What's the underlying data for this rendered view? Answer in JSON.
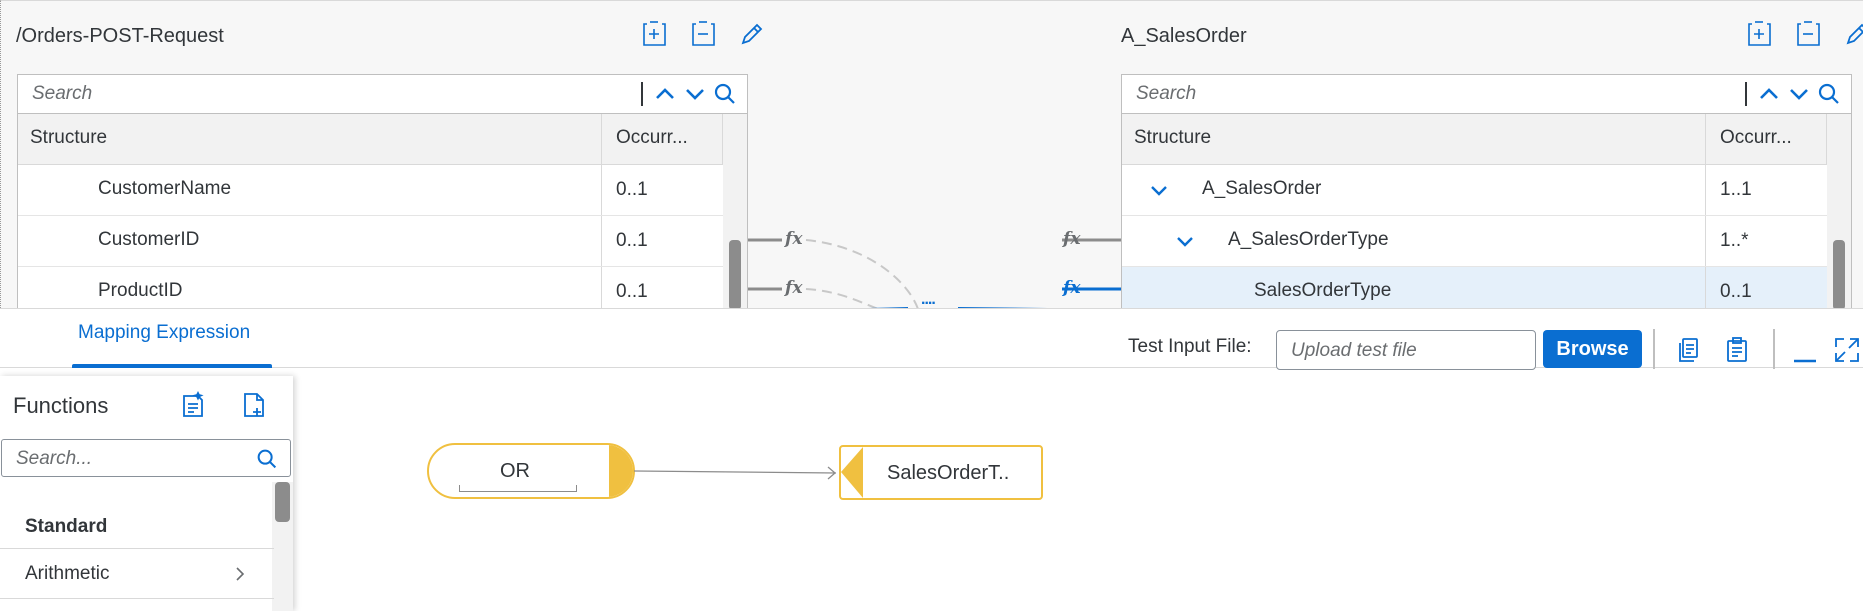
{
  "source": {
    "title": "/Orders-POST-Request",
    "search_placeholder": "Search",
    "columns": {
      "structure": "Structure",
      "occurrence": "Occurr..."
    },
    "rows": [
      {
        "name": "CustomerName",
        "occ": "0..1"
      },
      {
        "name": "CustomerID",
        "occ": "0..1"
      },
      {
        "name": "ProductID",
        "occ": "0..1"
      }
    ]
  },
  "target": {
    "title": "A_SalesOrder",
    "search_placeholder": "Search",
    "columns": {
      "structure": "Structure",
      "occurrence": "Occurr..."
    },
    "rows": [
      {
        "name": "A_SalesOrder",
        "occ": "1..1",
        "expanded": true
      },
      {
        "name": "A_SalesOrderType",
        "occ": "1..*",
        "expanded": true
      },
      {
        "name": "SalesOrderType",
        "occ": "0..1",
        "selected": true
      }
    ]
  },
  "mapping_labels": {
    "fx": "fx",
    "collapsed": "...."
  },
  "tabs": [
    {
      "label": "Mapping Expression",
      "active": true
    }
  ],
  "test_input": {
    "label": "Test Input File:",
    "placeholder": "Upload test file",
    "browse": "Browse"
  },
  "functions": {
    "title": "Functions",
    "search_placeholder": "Search...",
    "section": "Standard",
    "items": [
      {
        "label": "Arithmetic"
      }
    ]
  },
  "canvas": {
    "function_node": "OR",
    "target_node": "SalesOrderT.."
  },
  "colors": {
    "accent": "#0a6ed1",
    "node_border": "#f0c040",
    "selected_row": "#e5f0fa"
  }
}
